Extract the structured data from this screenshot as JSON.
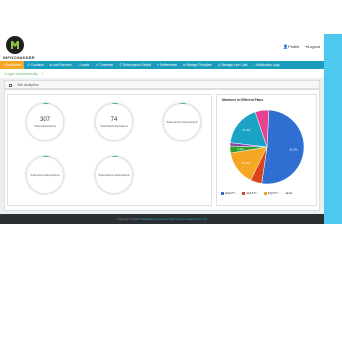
{
  "header": {
    "logo_text": "INFOCHAKKER",
    "profile_label": "Profile",
    "logout_label": "Logout"
  },
  "nav": {
    "items": [
      {
        "label": "Dashboard",
        "icon": "home-icon"
      },
      {
        "label": "Contacts",
        "icon": "phone-icon"
      },
      {
        "label": "Add Services",
        "icon": "plus-icon"
      },
      {
        "label": "Leads",
        "icon": "chart-icon"
      },
      {
        "label": "Customer",
        "icon": "user-icon"
      },
      {
        "label": "Subscription Details",
        "icon": "list-icon"
      },
      {
        "label": "Settlements",
        "icon": "money-icon"
      },
      {
        "label": "Manage Template",
        "icon": "template-icon"
      },
      {
        "label": "Manage Live Calls",
        "icon": "call-icon"
      },
      {
        "label": "Notification Logs",
        "icon": "bell-icon"
      }
    ]
  },
  "status_message": "Login successfully....!",
  "panel": {
    "title": "Site Analytics"
  },
  "stats": [
    {
      "value": "307",
      "label": "Total Subscriptions"
    },
    {
      "value": "74",
      "label": "Total Paid Subscriptions"
    },
    {
      "value": "",
      "label": "Total Inactive Subscriptions"
    },
    {
      "value": "",
      "label": "Total Active Subscriptions"
    },
    {
      "value": "",
      "label": "Total Inactive Subscriptions"
    }
  ],
  "chart_data": {
    "type": "pie",
    "title": "Members in Different Plans",
    "series": [
      {
        "name": "EQUITY ...",
        "value": 51.5,
        "label": "51.5%",
        "color": "#2e6fd1"
      },
      {
        "name": "EQUITY ...",
        "value": 5.0,
        "label": "",
        "color": "#d9441a"
      },
      {
        "name": "EQUITY ...",
        "value": 15.1,
        "label": "15.1%",
        "color": "#f5a623"
      },
      {
        "name": "",
        "value": 3.0,
        "label": "3.3%",
        "color": "#2ca02c"
      },
      {
        "name": "",
        "value": 1.5,
        "label": "",
        "color": "#8e44ad"
      },
      {
        "name": "",
        "value": 17.9,
        "label": "17.9%",
        "color": "#1aa3c4"
      },
      {
        "name": "",
        "value": 6.0,
        "label": "",
        "color": "#e84393"
      }
    ],
    "legend_labels": [
      "EQUITY ...",
      "EQUITY ...",
      "EQUITY ..."
    ],
    "legend_pager": "1/3"
  },
  "footer": {
    "prefix": "Copyright © 2019 ",
    "link": "Infochakker Investment Tips Trading Academy Pvt. Ltd"
  }
}
